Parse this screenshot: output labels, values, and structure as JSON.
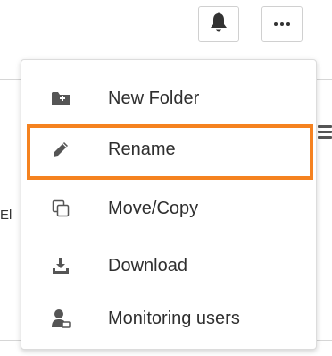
{
  "background": {
    "partial_text": "El"
  },
  "toolbar": {
    "buttons": [
      {
        "name": "notifications",
        "icon": "bell-icon"
      },
      {
        "name": "more",
        "icon": "ellipsis-icon"
      }
    ]
  },
  "menu": {
    "items": [
      {
        "label": "New Folder",
        "icon": "folder-plus-icon"
      },
      {
        "label": "Rename",
        "icon": "pencil-icon",
        "highlighted": true
      },
      {
        "label": "Move/Copy",
        "icon": "copy-icon"
      },
      {
        "label": "Download",
        "icon": "download-icon"
      },
      {
        "label": "Monitoring users",
        "icon": "user-monitor-icon"
      }
    ],
    "highlight_color": "#f58220"
  },
  "colors": {
    "icon": "#555555",
    "text": "#2f2f2f",
    "highlight": "#f58220"
  }
}
